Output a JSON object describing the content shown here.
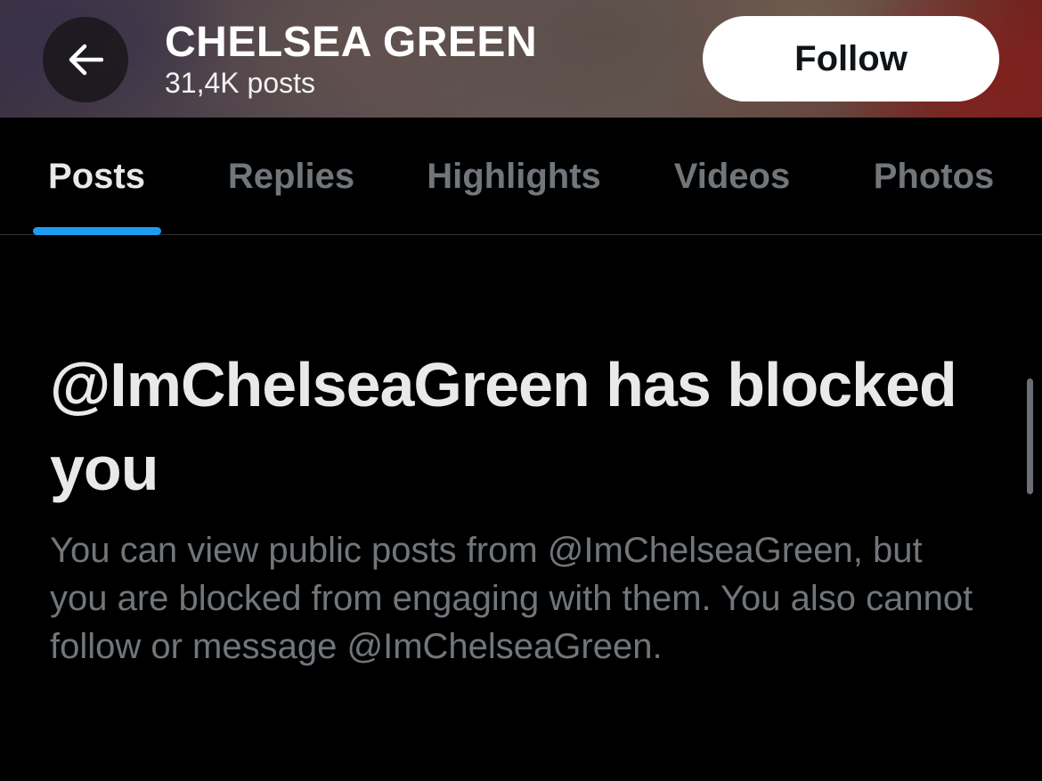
{
  "header": {
    "back_icon": "arrow-left-icon",
    "profile_name": "CHELSEA GREEN",
    "post_count": "31,4K posts",
    "follow_label": "Follow"
  },
  "tabs": [
    {
      "label": "Posts",
      "active": true
    },
    {
      "label": "Replies",
      "active": false
    },
    {
      "label": "Highlights",
      "active": false
    },
    {
      "label": "Videos",
      "active": false
    },
    {
      "label": "Photos",
      "active": false
    }
  ],
  "blocked": {
    "title": "@ImChelseaGreen has blocked you",
    "description": "You can view public posts from @ImChelseaGreen, but you are blocked from engaging with them. You also cannot follow or message @ImChelseaGreen."
  },
  "colors": {
    "background": "#000000",
    "accent": "#1d9bf0",
    "primary_text": "#e7e9ea",
    "secondary_text": "#71767b",
    "follow_button_bg": "#ffffff"
  }
}
